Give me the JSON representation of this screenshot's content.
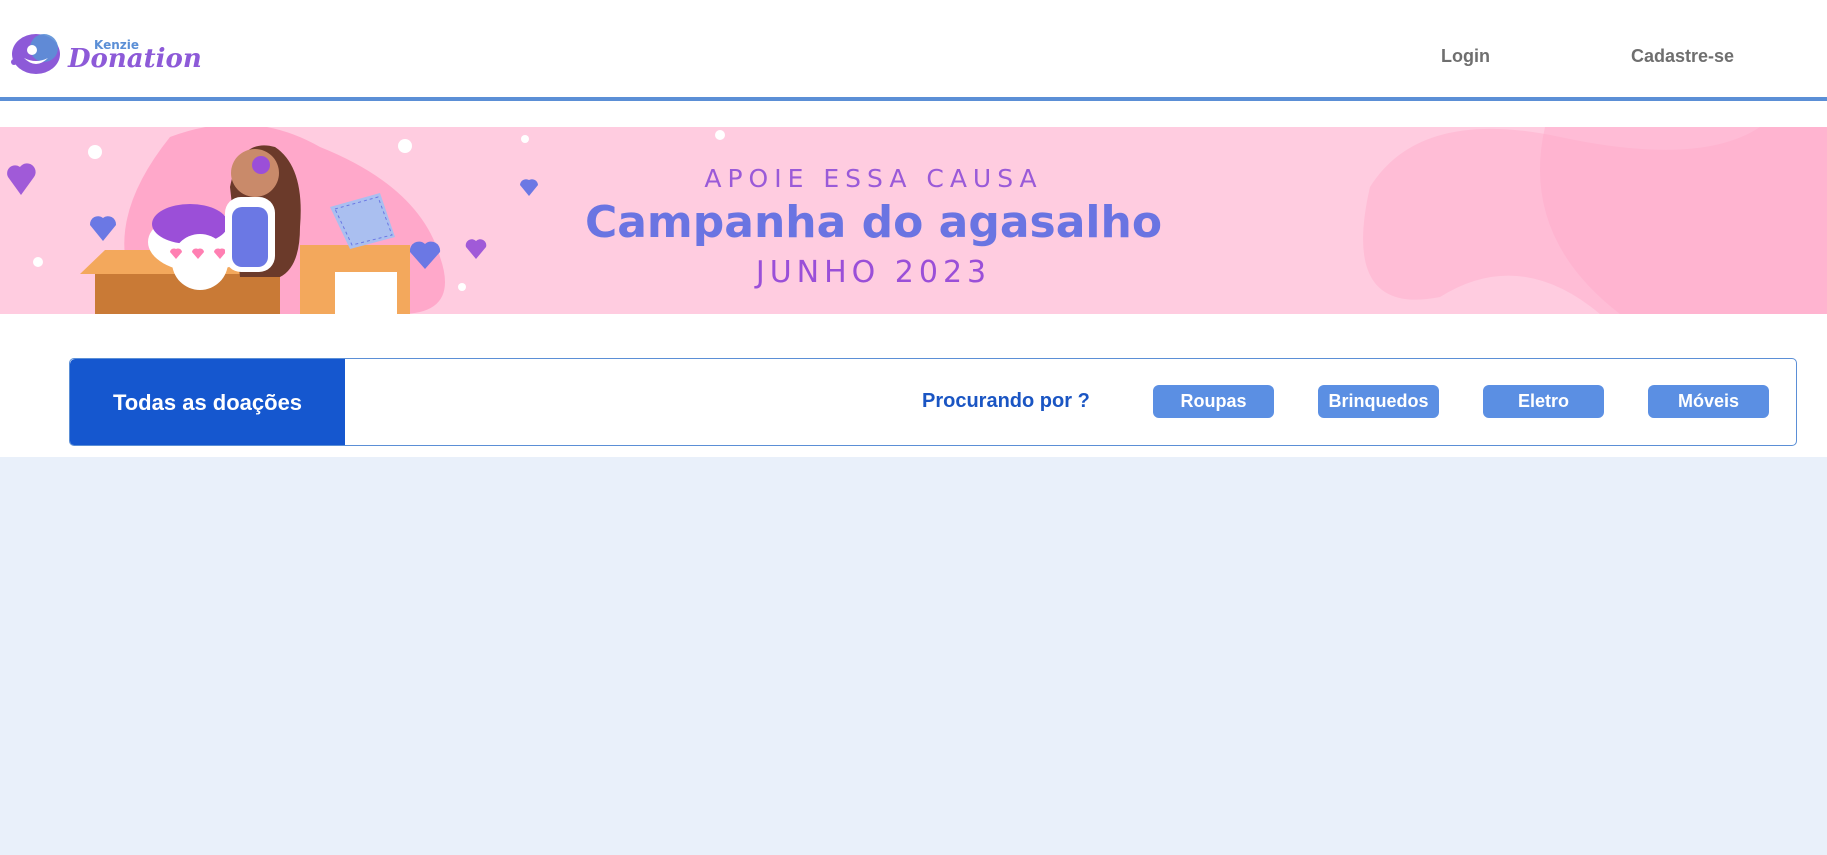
{
  "header": {
    "logo": {
      "small": "Kenzie",
      "big": "Donation"
    },
    "nav": {
      "login": "Login",
      "signup": "Cadastre-se"
    }
  },
  "banner": {
    "subtitle": "APOIE ESSA CAUSA",
    "title": "Campanha do agasalho",
    "date": "JUNHO 2023"
  },
  "filters": {
    "all_label": "Todas as doações",
    "search_label": "Procurando por ?",
    "categories": [
      "Roupas",
      "Brinquedos",
      "Eletro",
      "Móveis"
    ]
  },
  "colors": {
    "primary": "#1557cf",
    "accent": "#5b8fe3",
    "banner_bg": "#ffcce0",
    "content_bg": "#e9f0fa"
  }
}
